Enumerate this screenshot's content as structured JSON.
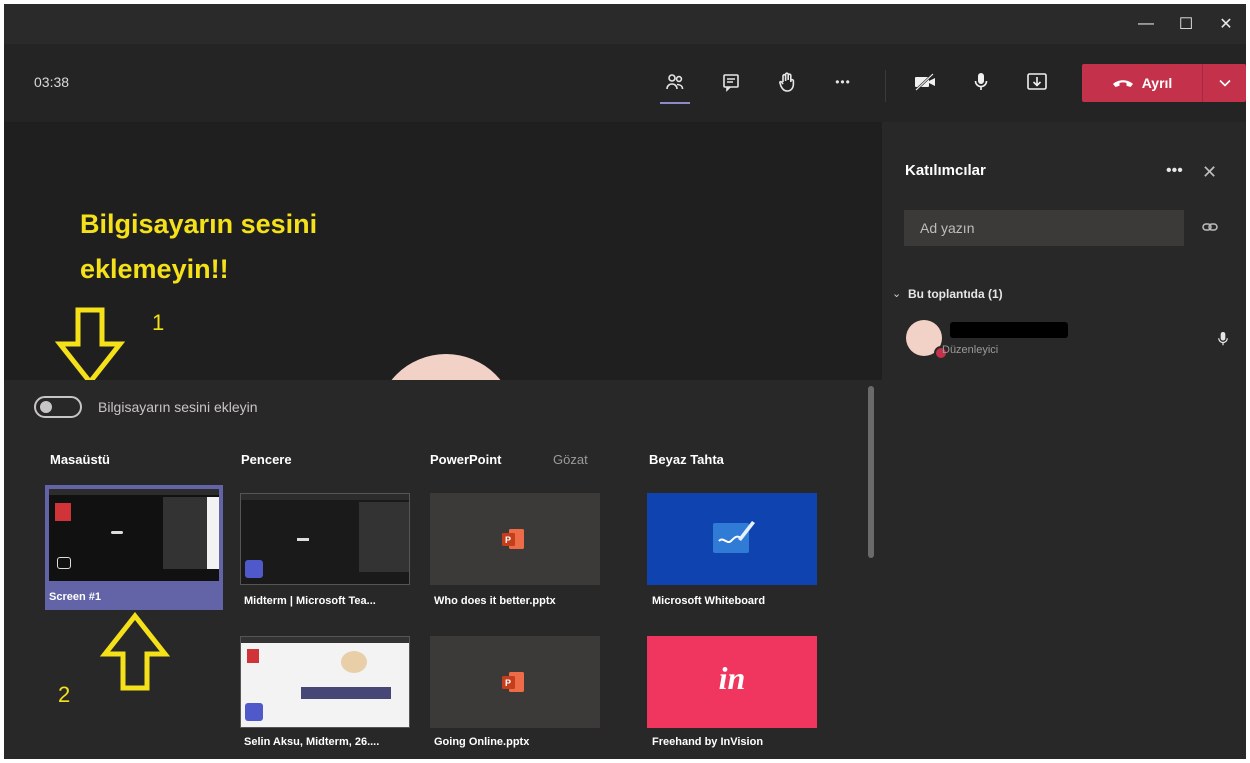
{
  "window": {
    "minimize_glyph": "—",
    "maximize_glyph": "☐",
    "close_glyph": "✕"
  },
  "toolbar": {
    "timer": "03:38",
    "icons": [
      "people-icon",
      "chat-icon",
      "raise-hand-icon",
      "more-icon",
      "camera-off-icon",
      "microphone-icon",
      "share-tray-icon"
    ],
    "more_glyph": "•••",
    "leave_label": "Ayrıl",
    "leave_color": "#c4314b"
  },
  "annotations": {
    "warning": "Bilgisayarın sesini\neklemeyin!!",
    "step1": "1",
    "step2": "2",
    "color": "#f5e11a"
  },
  "share_tray": {
    "toggle_label": "Bilgisayarın sesini ekleyin",
    "toggle_on": false,
    "categories": {
      "desktop": "Masaüstü",
      "window": "Pencere",
      "powerpoint": "PowerPoint",
      "browse": "Gözat",
      "whiteboard": "Beyaz Tahta"
    },
    "desktop_tiles": [
      {
        "label": "Screen #1",
        "selected": true
      }
    ],
    "window_tiles": [
      {
        "label": "Midterm | Microsoft Tea..."
      },
      {
        "label": "Selin Aksu, Midterm, 26...."
      }
    ],
    "powerpoint_tiles": [
      {
        "label": "Who does it better.pptx"
      },
      {
        "label": "Going Online.pptx"
      }
    ],
    "whiteboard_tiles": [
      {
        "label": "Microsoft Whiteboard",
        "color": "#0f43b0"
      },
      {
        "label": "Freehand by InVision",
        "color": "#f0365f",
        "logo": "in"
      }
    ]
  },
  "participants": {
    "title": "Katılımcılar",
    "more_glyph": "•••",
    "close_glyph": "✕",
    "search_placeholder": "Ad yazın",
    "group_label": "Bu toplantıda (1)",
    "group_chevron": "⌄",
    "people": [
      {
        "role": "Düzenleyici"
      }
    ]
  }
}
